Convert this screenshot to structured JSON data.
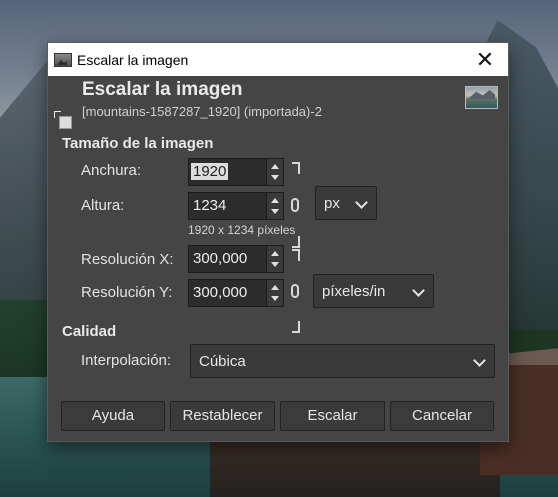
{
  "window": {
    "title": "Escalar la imagen"
  },
  "header": {
    "title": "Escalar la imagen",
    "subtitle": "[mountains-1587287_1920] (importada)-2"
  },
  "image_size": {
    "section_label": "Tamaño de la imagen",
    "width_label": "Anchura:",
    "width_value": "1920",
    "height_label": "Altura:",
    "height_value": "1234",
    "unit": "px",
    "size_hint": "1920 x 1234 píxeles",
    "res_x_label": "Resolución X:",
    "res_x_value": "300,000",
    "res_y_label": "Resolución Y:",
    "res_y_value": "300,000",
    "res_unit": "píxeles/in"
  },
  "quality": {
    "section_label": "Calidad",
    "interp_label": "Interpolación:",
    "interp_value": "Cúbica"
  },
  "buttons": {
    "help": "Ayuda",
    "reset": "Restablecer",
    "scale": "Escalar",
    "cancel": "Cancelar"
  }
}
